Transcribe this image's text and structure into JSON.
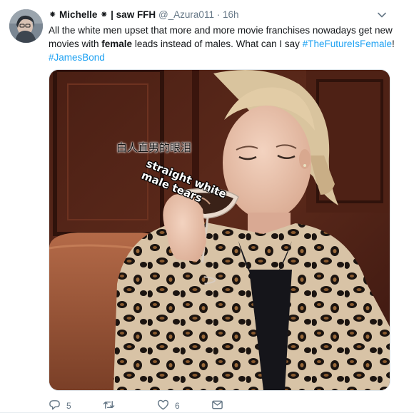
{
  "tweet": {
    "display_name": "⁕ Michelle ⁕ | saw FFH",
    "handle": "@_Azura011",
    "separator": "·",
    "time": "16h",
    "text_part1": "All the white men upset that more and more movie franchises nowadays get new movies with ",
    "text_bold": "female",
    "text_part2": " leads instead of males. What can I say ",
    "hashtag1": "#TheFutureIsFemale",
    "text_part3": "!",
    "hashtag2": "#JamesBond"
  },
  "media": {
    "caption_cn": "白人直男的眼泪",
    "caption_en_line1": "straight white",
    "caption_en_line2": "male tears"
  },
  "actions": {
    "reply_count": "5",
    "retweet_count": "",
    "like_count": "6"
  },
  "icons": {
    "reply": "reply-icon",
    "retweet": "retweet-icon",
    "like": "heart-icon",
    "dm": "envelope-icon",
    "caret": "chevron-down-icon"
  },
  "colors": {
    "link": "#1da1f2",
    "secondary": "#657786",
    "text": "#14171a"
  }
}
